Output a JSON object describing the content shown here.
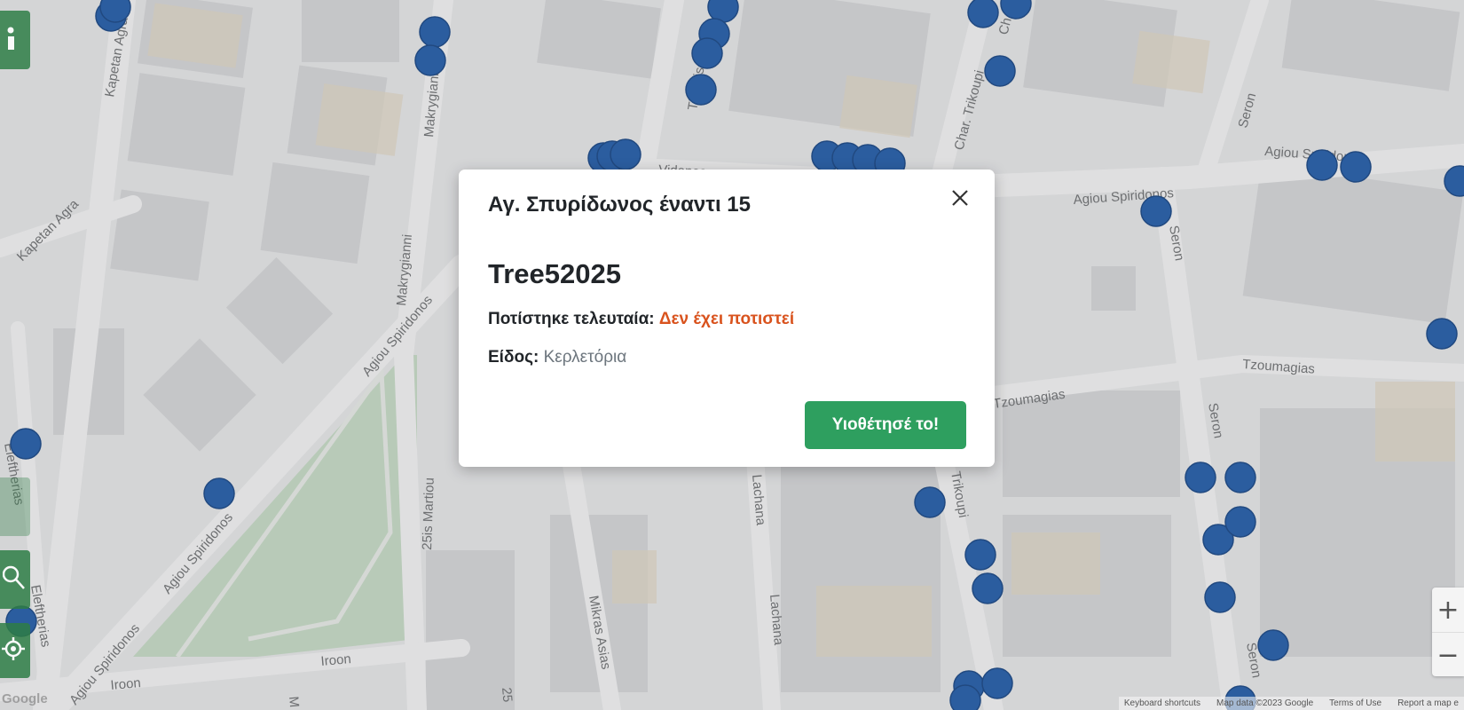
{
  "map": {
    "street_labels": [
      "Kapetan Agra",
      "Kapetan Agra",
      "Makrygianni",
      "Makrygianni",
      "Thrakis",
      "Char. Trikoupi",
      "Seron",
      "Agiou Spiridonos",
      "Agiou Spiridonos",
      "Agiou Spiridonos",
      "Agiou Spiridonos",
      "Agiou Spiridonos",
      "Seron",
      "Tzoumagias",
      "Tzoumagias",
      "Seron",
      "25is Martiou",
      "Lachana",
      "Lachana",
      "Mikras Asias",
      "Trikoupi",
      "Iroon",
      "Iroon",
      "Eleftherias",
      "Eleftherias",
      "Seron",
      "Vidonos",
      "Ch.",
      "25",
      "M"
    ],
    "zoom_in": "+",
    "zoom_out": "−",
    "attribution": [
      "Keyboard shortcuts",
      "Map data ©2023 Google",
      "Terms of Use",
      "Report a map e"
    ],
    "logo": "Google",
    "marker_color": "#1a57a8"
  },
  "side_controls": {
    "info_icon": "info-icon",
    "search_icon": "search-icon",
    "locate_icon": "locate-icon"
  },
  "modal": {
    "title": "Αγ. Σπυρίδωνος έναντι 15",
    "close_icon": "close-icon",
    "tree_id": "Tree52025",
    "watered_label": "Ποτίστηκε τελευταία:",
    "watered_value": "Δεν έχει ποτιστεί",
    "species_label": "Είδος:",
    "species_value": "Κερλετόρια",
    "adopt_button": "Υιοθέτησέ το!"
  },
  "colors": {
    "accent_green": "#2e9f5f",
    "warning_orange": "#d9531e",
    "marker_blue": "#1a57a8"
  }
}
